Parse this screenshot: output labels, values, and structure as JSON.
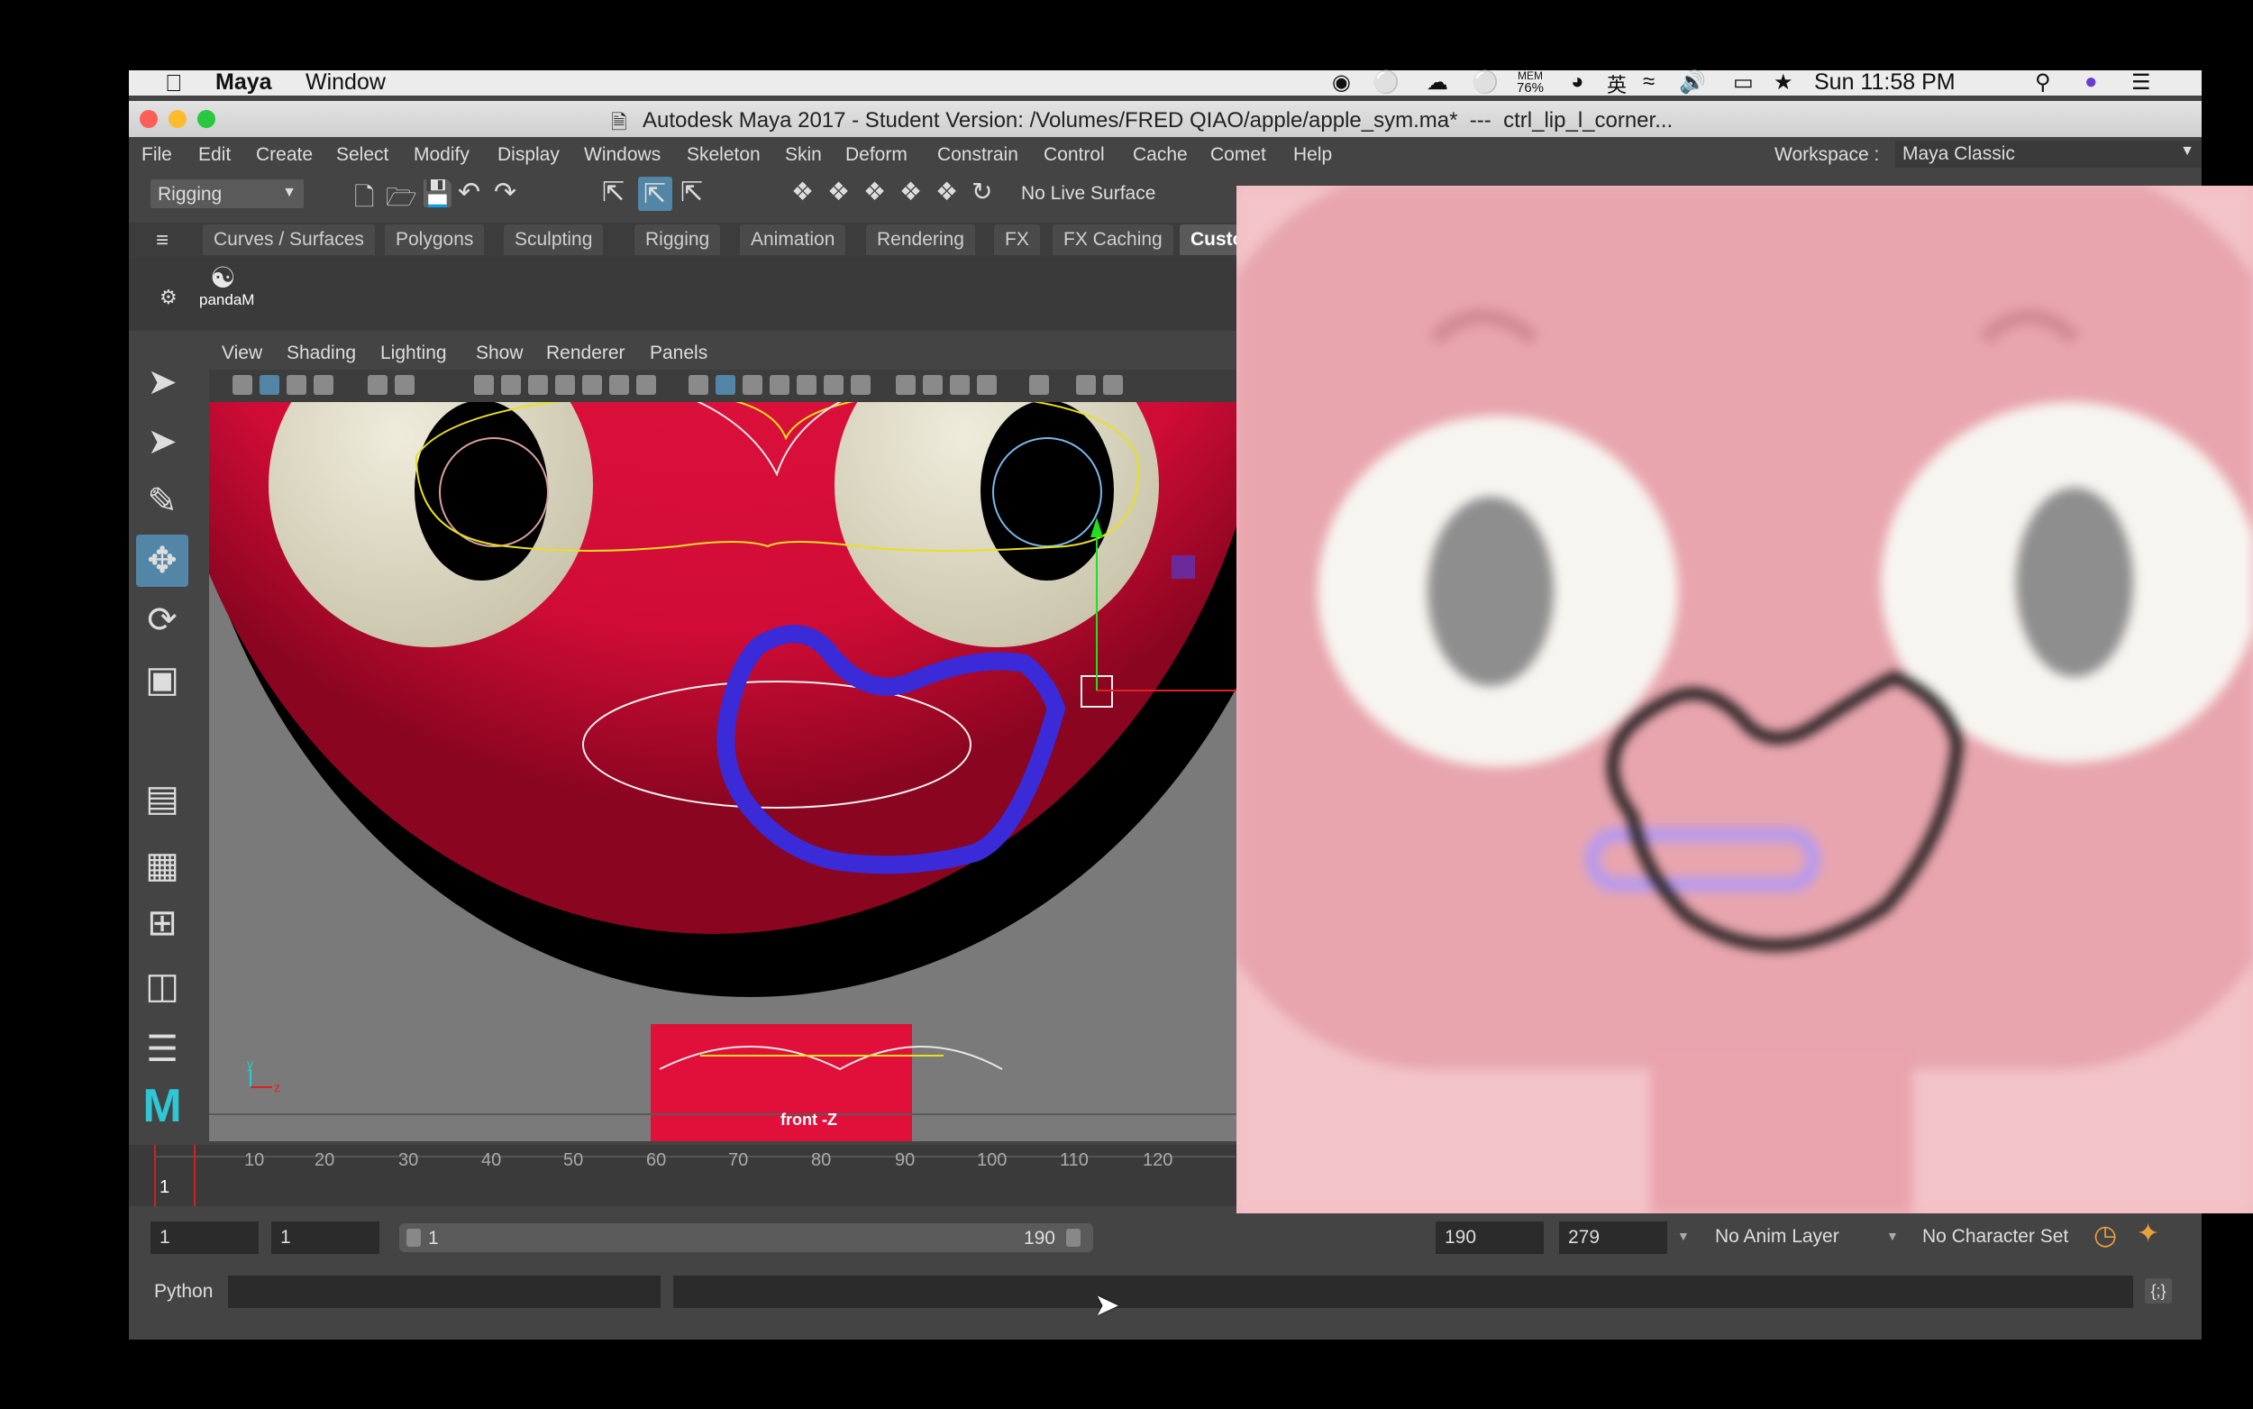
{
  "menubar": {
    "app_name": "Maya",
    "window_menu": "Window",
    "mem_label": "MEM",
    "mem_value": "76%",
    "ime_label": "英",
    "clock": "Sun 11:58 PM"
  },
  "titlebar": {
    "title": "Autodesk Maya 2017 - Student Version: /Volumes/FRED QIAO/apple/apple_sym.ma*  ---  ctrl_lip_l_corner..."
  },
  "main_menu": {
    "items": [
      "File",
      "Edit",
      "Create",
      "Select",
      "Modify",
      "Display",
      "Windows",
      "Skeleton",
      "Skin",
      "Deform",
      "Constrain",
      "Control",
      "Cache",
      "Comet",
      "Help"
    ],
    "workspace_label": "Workspace :",
    "workspace_value": "Maya Classic"
  },
  "status_line": {
    "menuset": "Rigging",
    "live_surface": "No Live Surface"
  },
  "shelf": {
    "tabs": [
      "Curves / Surfaces",
      "Polygons",
      "Sculpting",
      "Rigging",
      "Animation",
      "Rendering",
      "FX",
      "FX Caching",
      "Custo"
    ],
    "button_label": "pandaM"
  },
  "panel_menu": {
    "items": [
      "View",
      "Shading",
      "Lighting",
      "Show",
      "Renderer",
      "Panels"
    ]
  },
  "viewport": {
    "camera_label": "front -Z",
    "axis_y": "y",
    "axis_z": "z"
  },
  "timeline": {
    "ticks": [
      "10",
      "20",
      "30",
      "40",
      "50",
      "60",
      "70",
      "80",
      "90",
      "100",
      "110",
      "120"
    ],
    "current_frame": "1"
  },
  "range_slider": {
    "start_frame": "1",
    "playback_start": "1",
    "slider_start": "1",
    "slider_end": "190",
    "playback_end": "190",
    "end_frame": "279",
    "anim_layer": "No Anim Layer",
    "character_set": "No Character Set"
  },
  "command_line": {
    "language": "Python"
  },
  "colors": {
    "maya_bg": "#444444",
    "face_red": "#e0103a",
    "lip_blue": "#3a2ad8",
    "selection_highlight": "#5285a6",
    "overlay_pink": "#f0b9c0"
  }
}
